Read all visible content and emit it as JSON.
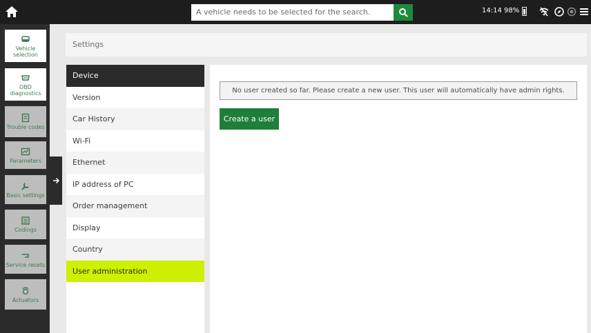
{
  "topbar": {
    "search_placeholder": "A vehicle needs to be selected for the search.",
    "time": "14:14",
    "battery": "98%"
  },
  "rail": {
    "items": [
      {
        "label": "Vehicle selection",
        "icon": "car-icon"
      },
      {
        "label": "OBD diagnostics",
        "icon": "obd-icon"
      },
      {
        "label": "Trouble codes",
        "icon": "trouble-codes-icon"
      },
      {
        "label": "Parameters",
        "icon": "parameters-icon"
      },
      {
        "label": "Basic settings",
        "icon": "wrench-icon"
      },
      {
        "label": "Codings",
        "icon": "codings-icon"
      },
      {
        "label": "Service resets",
        "icon": "service-reset-icon"
      },
      {
        "label": "Actuators",
        "icon": "actuators-icon"
      }
    ]
  },
  "settings": {
    "title": "Settings"
  },
  "menu": {
    "items": [
      {
        "label": "Device"
      },
      {
        "label": "Version"
      },
      {
        "label": "Car History"
      },
      {
        "label": "Wi-Fi"
      },
      {
        "label": "Ethernet"
      },
      {
        "label": "IP address of PC"
      },
      {
        "label": "Order management"
      },
      {
        "label": "Display"
      },
      {
        "label": "Country"
      },
      {
        "label": "User administration"
      }
    ]
  },
  "content": {
    "notice": "No user created so far. Please create a new user. This user will automatically have admin rights.",
    "create_button": "Create a user"
  },
  "colors": {
    "accent_green": "#1e7e3a",
    "selected_yellow": "#ccf000",
    "rail_dark": "#2b2b2b"
  }
}
